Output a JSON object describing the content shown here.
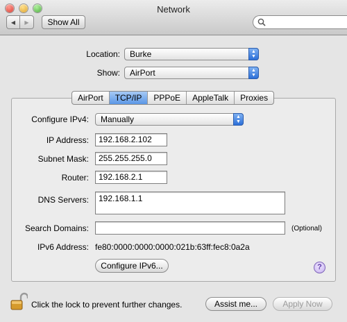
{
  "window": {
    "title": "Network"
  },
  "toolbar": {
    "back_glyph": "◀",
    "forward_glyph": "▶",
    "show_all_label": "Show All",
    "search_placeholder": ""
  },
  "location": {
    "label": "Location:",
    "value": "Burke"
  },
  "show": {
    "label": "Show:",
    "value": "AirPort"
  },
  "tabs": [
    {
      "label": "AirPort",
      "selected": false
    },
    {
      "label": "TCP/IP",
      "selected": true
    },
    {
      "label": "PPPoE",
      "selected": false
    },
    {
      "label": "AppleTalk",
      "selected": false
    },
    {
      "label": "Proxies",
      "selected": false
    }
  ],
  "tcpip": {
    "configure_label": "Configure IPv4:",
    "configure_value": "Manually",
    "ip_label": "IP Address:",
    "ip_value": "192.168.2.102",
    "subnet_label": "Subnet Mask:",
    "subnet_value": "255.255.255.0",
    "router_label": "Router:",
    "router_value": "192.168.2.1",
    "dns_label": "DNS Servers:",
    "dns_value": "192.168.1.1",
    "search_label": "Search Domains:",
    "search_value": "",
    "optional_label": "(Optional)",
    "ipv6_label": "IPv6 Address:",
    "ipv6_value": "fe80:0000:0000:0000:021b:63ff:fec8:0a2a",
    "configure_ipv6_button": "Configure IPv6...",
    "help_glyph": "?"
  },
  "footer": {
    "lock_text": "Click the lock to prevent further changes.",
    "assist_label": "Assist me...",
    "apply_label": "Apply Now"
  },
  "colors": {
    "accent": "#3b7ee0",
    "close": "#e0463b",
    "minimize": "#e6b131",
    "zoom": "#59b846",
    "help": "#8e66cf"
  }
}
